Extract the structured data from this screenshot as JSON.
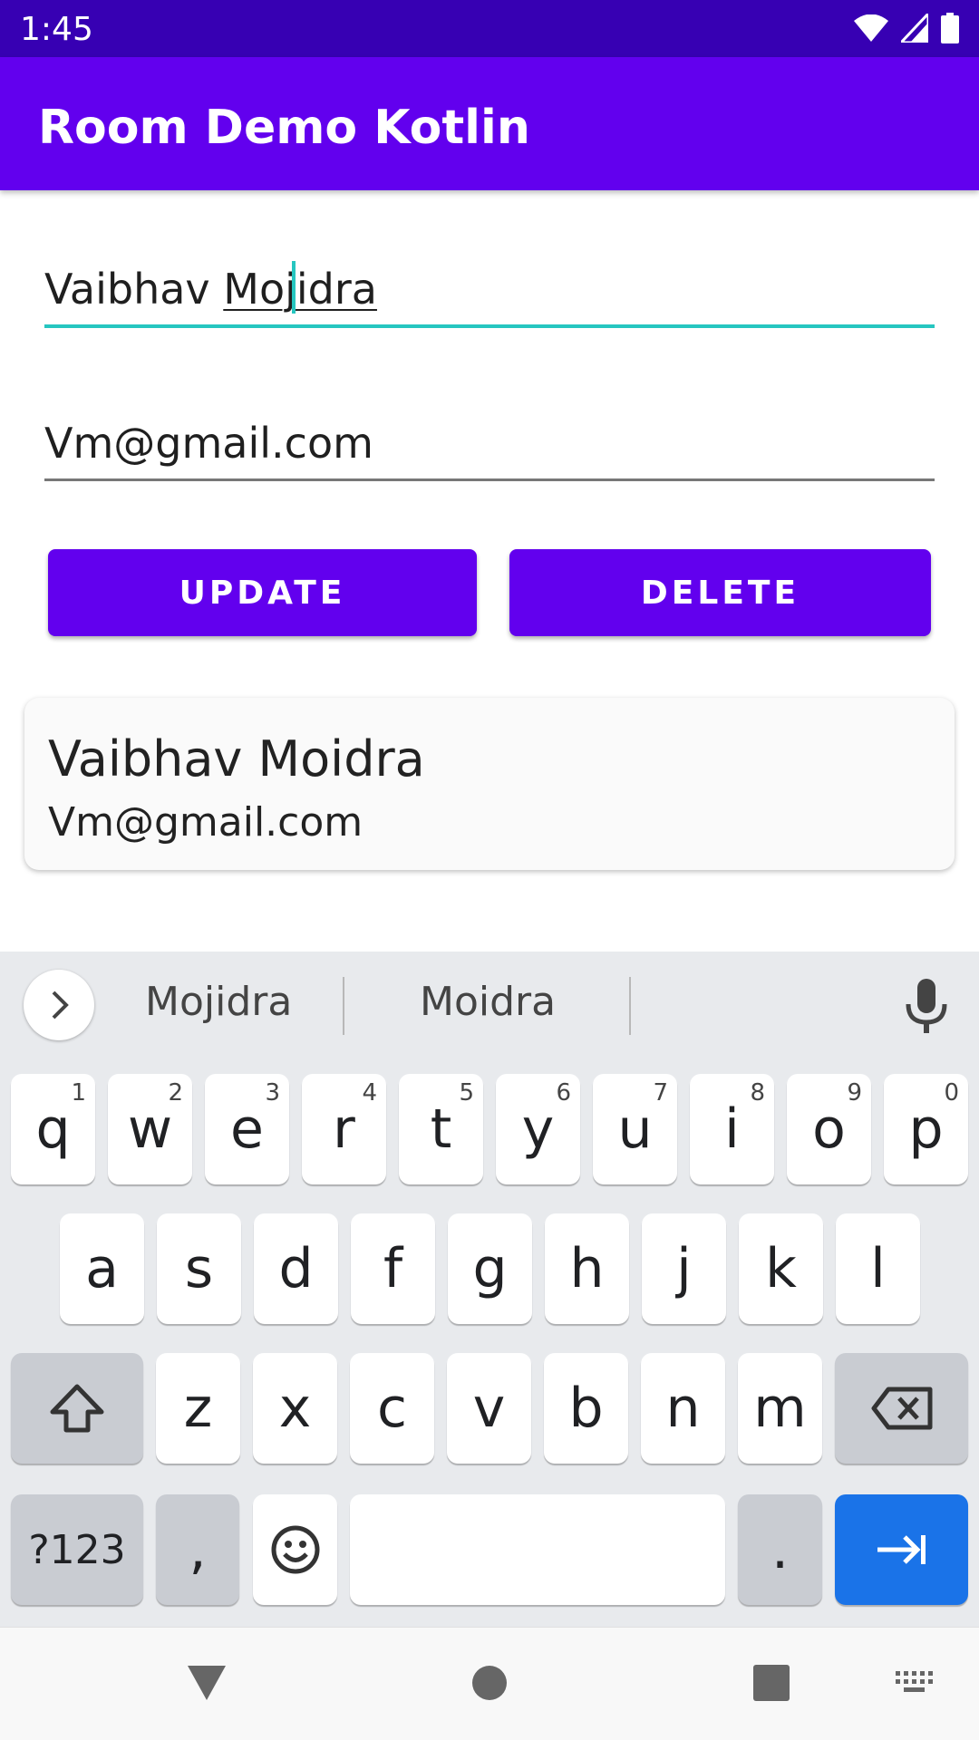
{
  "status_bar": {
    "time": "1:45"
  },
  "app_bar": {
    "title": "Room Demo Kotlin"
  },
  "form": {
    "name_value_prefix": "Vaibhav ",
    "name_value_composing": "Mojidra",
    "email_value": "Vm@gmail.com"
  },
  "buttons": {
    "update": "UPDATE",
    "delete": "DELETE"
  },
  "list": [
    {
      "name": "Vaibhav Moidra",
      "email": "Vm@gmail.com"
    }
  ],
  "keyboard": {
    "suggestions": [
      "Mojidra",
      "Moidra"
    ],
    "row1": [
      {
        "k": "q",
        "h": "1"
      },
      {
        "k": "w",
        "h": "2"
      },
      {
        "k": "e",
        "h": "3"
      },
      {
        "k": "r",
        "h": "4"
      },
      {
        "k": "t",
        "h": "5"
      },
      {
        "k": "y",
        "h": "6"
      },
      {
        "k": "u",
        "h": "7"
      },
      {
        "k": "i",
        "h": "8"
      },
      {
        "k": "o",
        "h": "9"
      },
      {
        "k": "p",
        "h": "0"
      }
    ],
    "row2": [
      "a",
      "s",
      "d",
      "f",
      "g",
      "h",
      "j",
      "k",
      "l"
    ],
    "row3": [
      "z",
      "x",
      "c",
      "v",
      "b",
      "n",
      "m"
    ],
    "symbols_label": "?123",
    "comma_label": ",",
    "period_label": ".",
    "enter_color": "#1a73e8"
  },
  "colors": {
    "primary": "#6200ee",
    "primary_dark": "#3700b3",
    "accent": "#26c6c0"
  }
}
